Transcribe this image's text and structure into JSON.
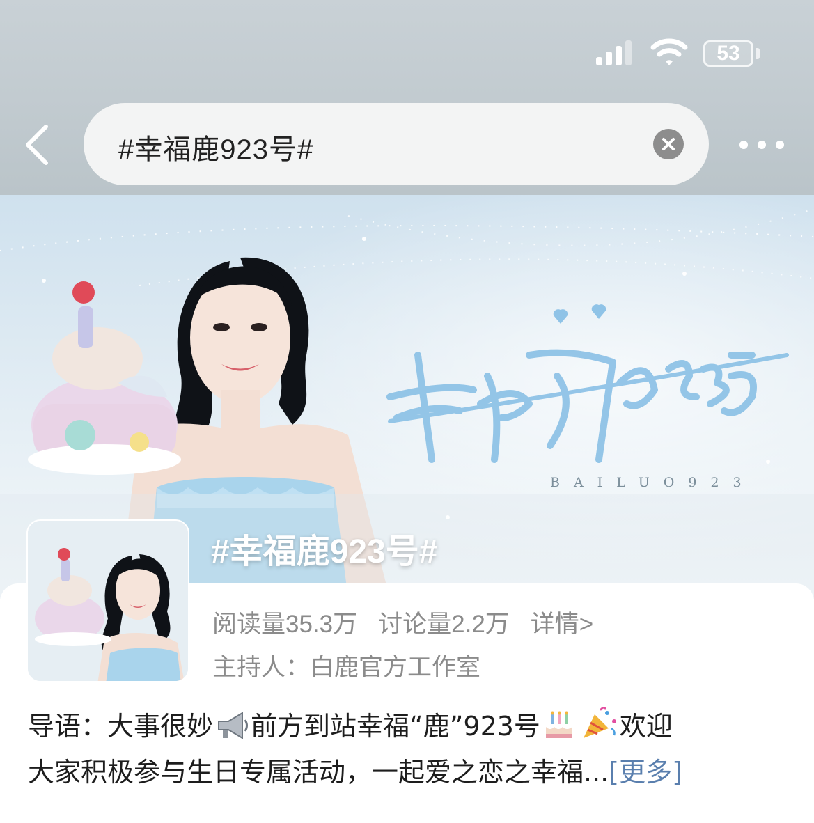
{
  "status_bar": {
    "battery": "53"
  },
  "search": {
    "query": "#幸福鹿923号#"
  },
  "banner": {
    "logo_subtitle": "BAILUO923"
  },
  "topic": {
    "title": "#幸福鹿923号#",
    "read_count": "阅读量35.3万",
    "discuss_count": "讨论量2.2万",
    "details_link": "详情>",
    "host": "主持人：白鹿官方工作室"
  },
  "intro": {
    "line1_part1": "导语：大事很妙",
    "line1_part2": "前方到站幸福“鹿”923号",
    "line1_part3": "欢迎",
    "line2": "大家积极参与生日专属活动，一起爱之恋之幸福...",
    "more": "[更多]"
  },
  "icons": {
    "back": "chevron-left-icon",
    "clear": "clear-icon",
    "more": "more-dots-icon",
    "megaphone": "megaphone-icon",
    "cake": "cake-icon",
    "party": "party-popper-icon"
  },
  "colors": {
    "link": "#5a7fae",
    "banner_sky": "#dbe8f1",
    "logo_blue": "#8fc3e7"
  }
}
